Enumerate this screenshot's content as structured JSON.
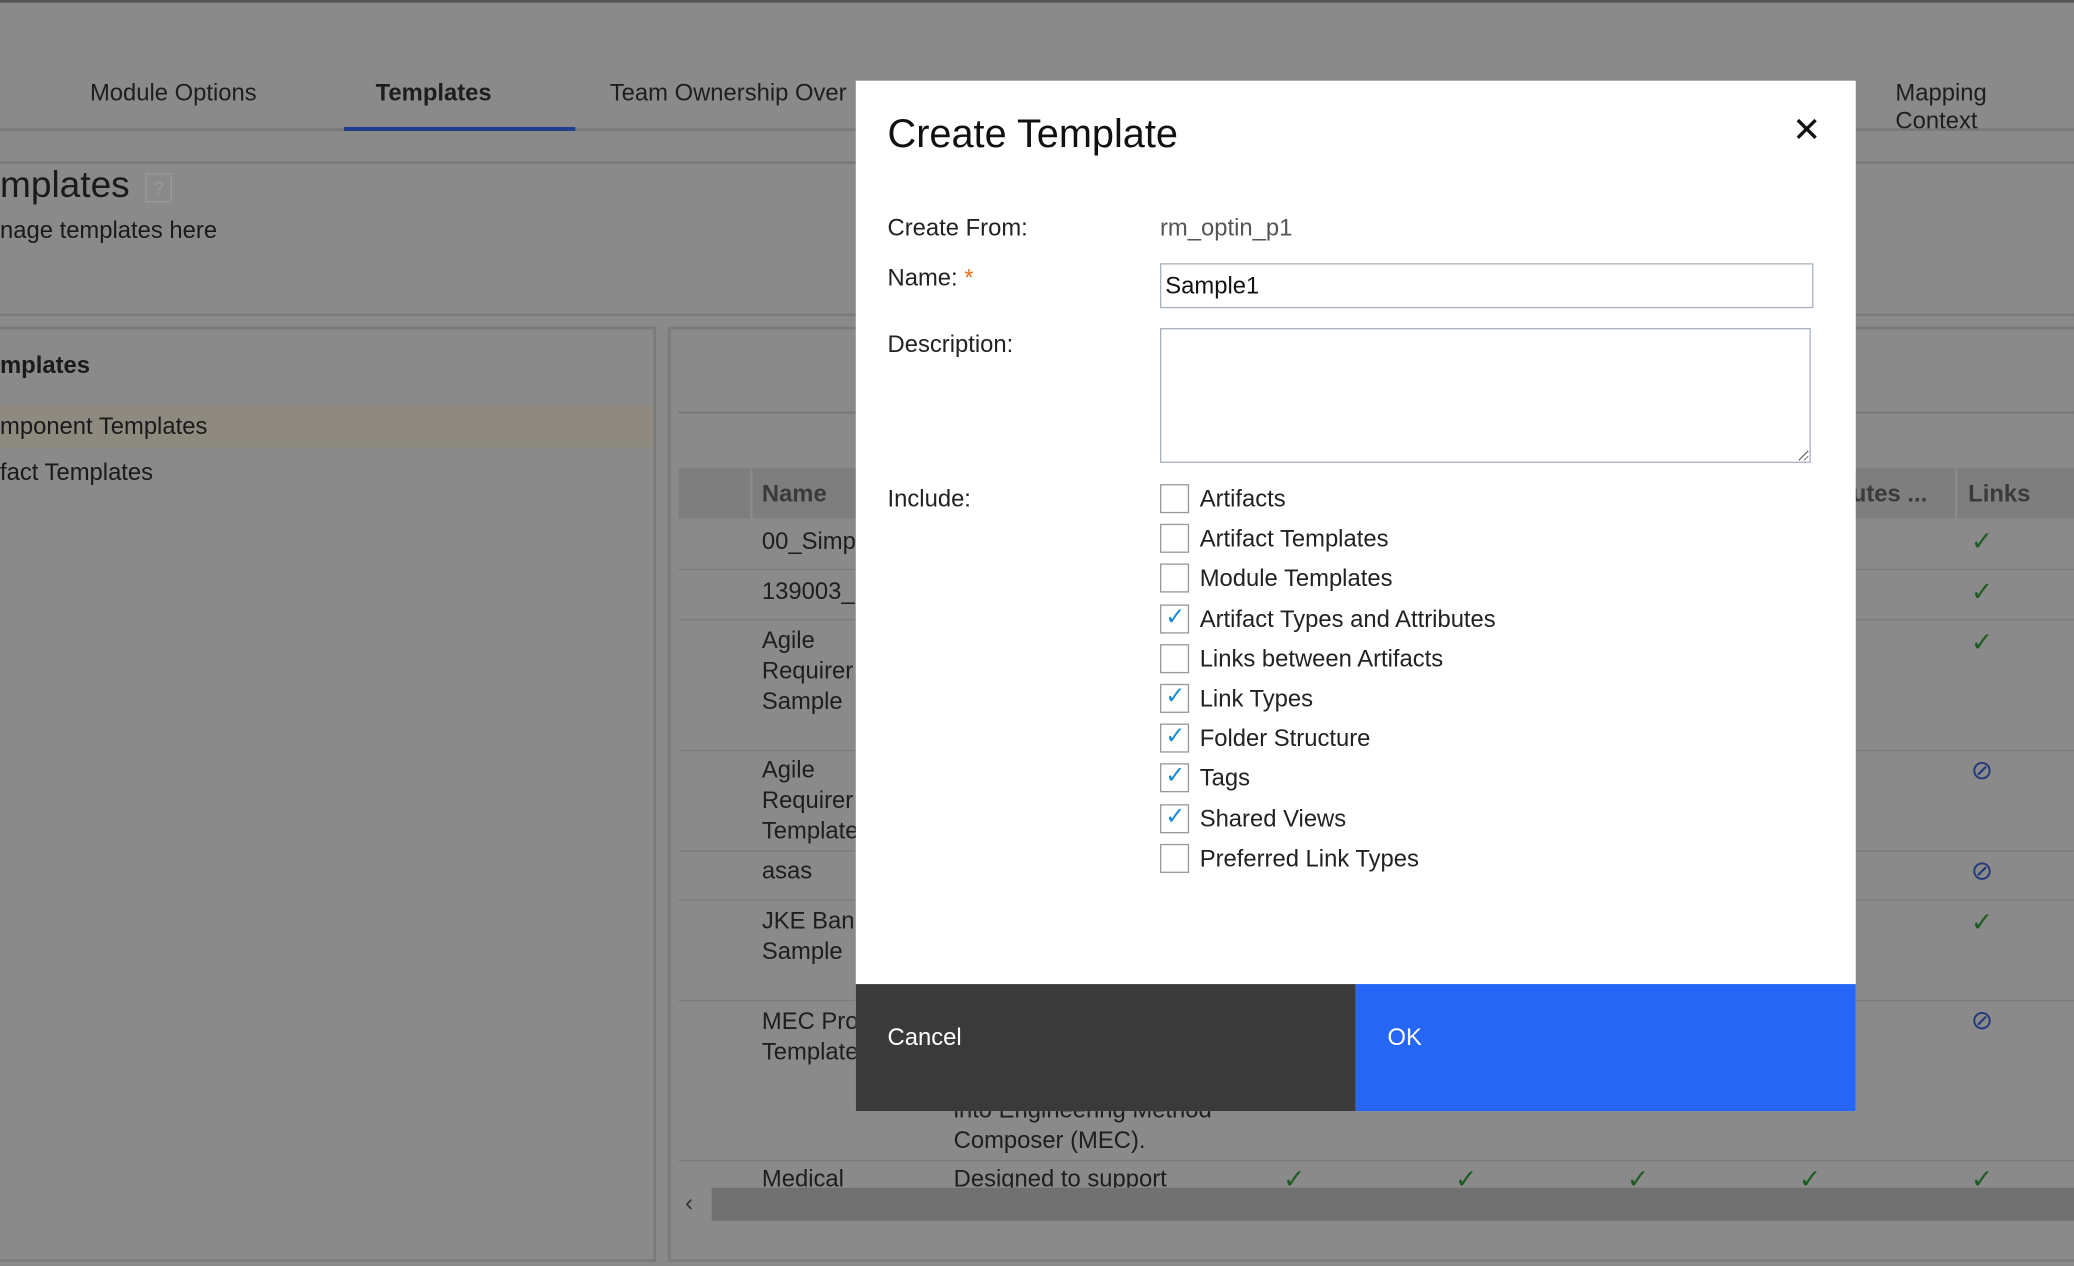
{
  "tabs": [
    {
      "label": "Module Options"
    },
    {
      "label": "Templates",
      "active": true
    },
    {
      "label": "Team Ownership Over"
    },
    {
      "label": "Mapping Context"
    }
  ],
  "page": {
    "title": "mplates",
    "subtitle": "nage templates here"
  },
  "left_panel": {
    "title": "mplates",
    "items": [
      {
        "label": "mponent Templates",
        "selected": true
      },
      {
        "label": "fact Templates"
      }
    ]
  },
  "table": {
    "headers": {
      "name": "Name",
      "attributes": "utes ...",
      "links": "Links"
    },
    "rows": [
      {
        "name": [
          "00_Simp"
        ],
        "links": "check"
      },
      {
        "name": [
          "139003_"
        ],
        "links": "check"
      },
      {
        "name": [
          "Agile",
          "Requirer",
          "Sample"
        ],
        "links": "check"
      },
      {
        "name": [
          "Agile",
          "Requirer",
          "Template"
        ],
        "links": "none"
      },
      {
        "name": [
          "asas"
        ],
        "links": "none"
      },
      {
        "name": [
          "JKE Ban",
          "Sample"
        ],
        "links": "check"
      },
      {
        "name": [
          "MEC Pro",
          "Template"
        ],
        "description": [
          "into Engineering Method",
          "Composer (MEC)."
        ],
        "links": "none"
      },
      {
        "name": [
          "Medical"
        ],
        "description": [
          "Designed to support"
        ],
        "links": "check"
      }
    ]
  },
  "dialog": {
    "title": "Create Template",
    "create_from_label": "Create From:",
    "create_from_value": "rm_optin_p1",
    "name_label": "Name:",
    "required_mark": "*",
    "name_value": "Sample1",
    "description_label": "Description:",
    "description_value": "",
    "include_label": "Include:",
    "include": [
      {
        "label": "Artifacts",
        "checked": false
      },
      {
        "label": "Artifact Templates",
        "checked": false
      },
      {
        "label": "Module Templates",
        "checked": false
      },
      {
        "label": "Artifact Types and Attributes",
        "checked": true
      },
      {
        "label": "Links between Artifacts",
        "checked": false
      },
      {
        "label": "Link Types",
        "checked": true
      },
      {
        "label": "Folder Structure",
        "checked": true
      },
      {
        "label": "Tags",
        "checked": true
      },
      {
        "label": "Shared Views",
        "checked": true
      },
      {
        "label": "Preferred Link Types",
        "checked": false
      }
    ],
    "cancel_label": "Cancel",
    "ok_label": "OK"
  },
  "colors": {
    "accent": "#2566f5",
    "cancel_bg": "#3a3a3a",
    "tab_underline": "#1f3f8f",
    "required": "#e8701a"
  }
}
